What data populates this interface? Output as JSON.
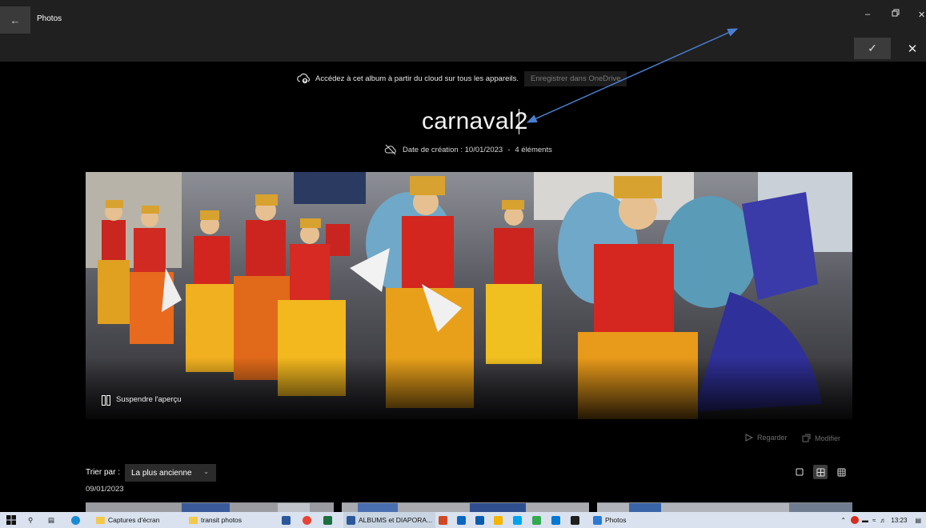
{
  "window": {
    "app_title": "Photos",
    "back_icon": "back-arrow-icon",
    "controls": [
      "minimize-icon",
      "restore-icon",
      "close-icon"
    ]
  },
  "command_bar": {
    "confirm_icon": "checkmark-icon",
    "cancel_icon": "close-icon"
  },
  "cloud": {
    "icon": "cloud-upload-icon",
    "message": "Accédez à cet album à partir du cloud sur tous les appareils.",
    "save_button": "Enregistrer dans OneDrive"
  },
  "album": {
    "title": "carnaval2",
    "meta_icon": "cloud-off-icon",
    "created": "Date de création : 10/01/2023",
    "separator": "-",
    "count": "4 éléments"
  },
  "hero": {
    "pause_label": "Suspendre l'aperçu",
    "pause_icon": "pause-icon"
  },
  "actions": {
    "watch": "Regarder",
    "watch_icon": "play-icon",
    "edit": "Modifier",
    "edit_icon": "edit-icon"
  },
  "sort": {
    "label": "Trier par :",
    "selected": "La plus ancienne",
    "chevron_icon": "chevron-down-icon"
  },
  "view_options": {
    "icons": [
      "single-view-icon",
      "grid-medium-icon",
      "grid-small-icon"
    ],
    "active_index": 1
  },
  "group": {
    "date": "09/01/2023"
  },
  "taskbar": {
    "items": [
      {
        "label": "Captures d'écran",
        "icon": "folder-icon"
      },
      {
        "label": "transit photos",
        "icon": "folder-icon"
      },
      {
        "label": "ALBUMS et DIAPORA...",
        "icon": "word-icon"
      },
      {
        "label": "Photos",
        "icon": "photos-icon"
      }
    ],
    "time": "13:23"
  },
  "colors": {
    "background": "#000000",
    "titlebar": "#202020",
    "accent": "#4a7fd1",
    "taskbar": "#d9e2ee"
  }
}
